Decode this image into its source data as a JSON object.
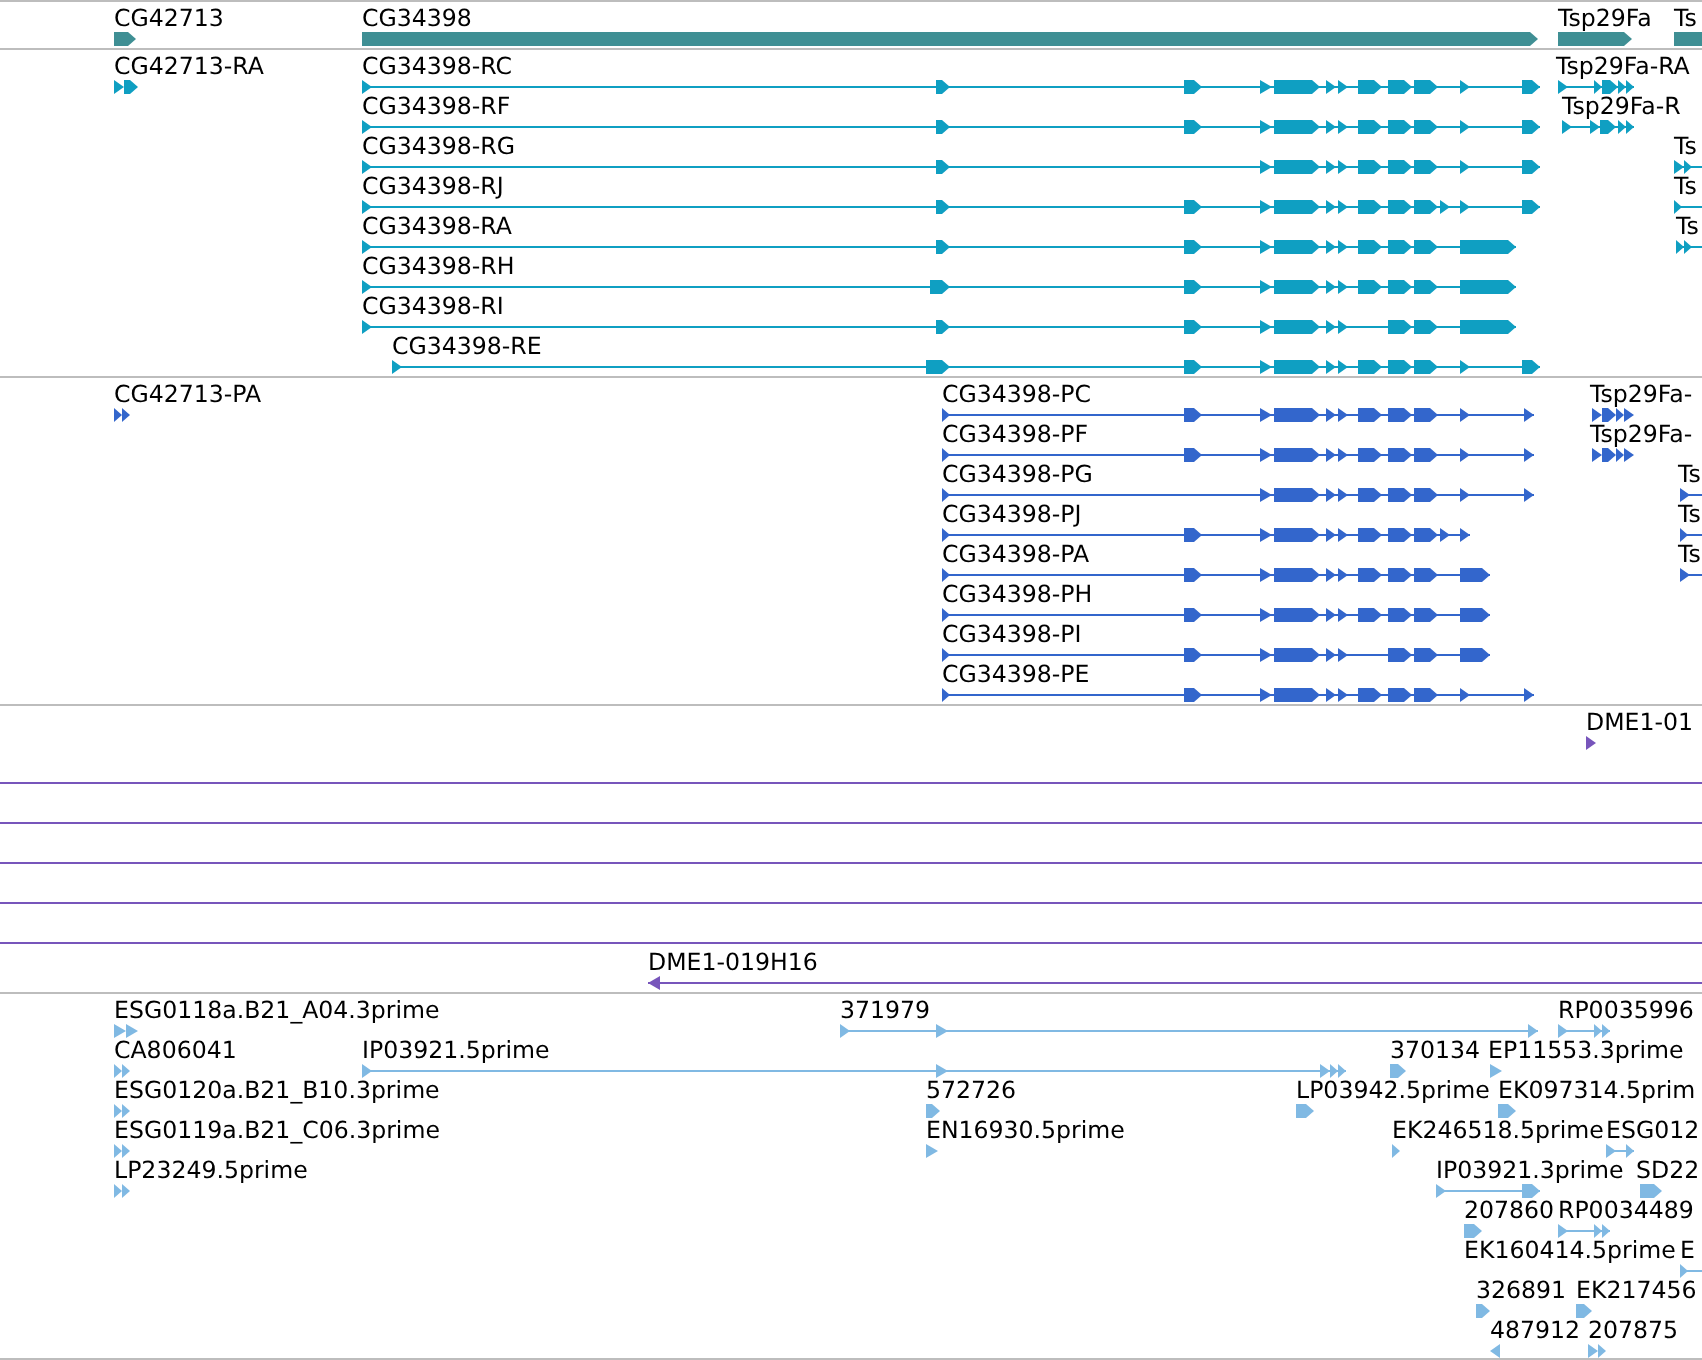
{
  "tracks": [
    {
      "kind": "gene",
      "features": [
        {
          "label": "CG42713",
          "reverse": false
        },
        {
          "label": "CG34398",
          "reverse": false
        },
        {
          "label": "Tsp29Fa",
          "reverse": false
        },
        {
          "label": "Ts",
          "reverse": false
        }
      ]
    },
    {
      "kind": "transcript",
      "features": [
        {
          "label": "CG42713-RA",
          "reverse": false
        },
        {
          "label": "CG34398-RC",
          "reverse": false
        },
        {
          "label": "Tsp29Fa-RA",
          "reverse": false
        },
        {
          "label": "CG34398-RF",
          "reverse": false
        },
        {
          "label": "Tsp29Fa-R",
          "reverse": false
        },
        {
          "label": "CG34398-RG",
          "reverse": false
        },
        {
          "label": "Ts",
          "reverse": false
        },
        {
          "label": "CG34398-RJ",
          "reverse": false
        },
        {
          "label": "Ts",
          "reverse": false
        },
        {
          "label": "CG34398-RA",
          "reverse": false
        },
        {
          "label": "Ts",
          "reverse": false
        },
        {
          "label": "CG34398-RH",
          "reverse": false
        },
        {
          "label": "CG34398-RI",
          "reverse": false
        },
        {
          "label": "CG34398-RE",
          "reverse": false
        }
      ]
    },
    {
      "kind": "protein",
      "features": [
        {
          "label": "CG42713-PA",
          "reverse": false
        },
        {
          "label": "CG34398-PC",
          "reverse": false
        },
        {
          "label": "Tsp29Fa-",
          "reverse": false
        },
        {
          "label": "CG34398-PF",
          "reverse": false
        },
        {
          "label": "Tsp29Fa-",
          "reverse": false
        },
        {
          "label": "CG34398-PG",
          "reverse": false
        },
        {
          "label": "Ts",
          "reverse": false
        },
        {
          "label": "CG34398-PJ",
          "reverse": false
        },
        {
          "label": "Ts",
          "reverse": false
        },
        {
          "label": "CG34398-PA",
          "reverse": false
        },
        {
          "label": "Ts",
          "reverse": false
        },
        {
          "label": "CG34398-PH",
          "reverse": false
        },
        {
          "label": "CG34398-PI",
          "reverse": false
        },
        {
          "label": "CG34398-PE",
          "reverse": false
        }
      ]
    },
    {
      "kind": "clone",
      "features": [
        {
          "label": "DME1-01",
          "reverse": false
        },
        {
          "label": "DME1-019H16",
          "reverse": true
        }
      ]
    },
    {
      "kind": "est",
      "features": [
        {
          "label": "ESG0118a.B21_A04.3prime",
          "reverse": false
        },
        {
          "label": "371979",
          "reverse": false
        },
        {
          "label": "RP0035996",
          "reverse": false
        },
        {
          "label": "CA806041",
          "reverse": false
        },
        {
          "label": "IP03921.5prime",
          "reverse": false
        },
        {
          "label": "370134",
          "reverse": false
        },
        {
          "label": "EP11553.3prime",
          "reverse": false
        },
        {
          "label": "ESG0120a.B21_B10.3prime",
          "reverse": false
        },
        {
          "label": "572726",
          "reverse": false
        },
        {
          "label": "LP03942.5prime",
          "reverse": false
        },
        {
          "label": "EK097314.5prim",
          "reverse": false
        },
        {
          "label": "ESG0119a.B21_C06.3prime",
          "reverse": false
        },
        {
          "label": "EN16930.5prime",
          "reverse": false
        },
        {
          "label": "EK246518.5prime",
          "reverse": false
        },
        {
          "label": "ESG012",
          "reverse": false
        },
        {
          "label": "LP23249.5prime",
          "reverse": false
        },
        {
          "label": "IP03921.3prime",
          "reverse": false
        },
        {
          "label": "SD22",
          "reverse": false
        },
        {
          "label": "207860",
          "reverse": false
        },
        {
          "label": "RP0034489",
          "reverse": false
        },
        {
          "label": "EK160414.5prime"
        },
        {
          "label": "E",
          "reverse": false
        },
        {
          "label": "326891",
          "reverse": false
        },
        {
          "label": "EK217456",
          "reverse": false
        },
        {
          "label": "487912",
          "reverse": true
        },
        {
          "label": "207875",
          "reverse": false
        }
      ]
    }
  ]
}
